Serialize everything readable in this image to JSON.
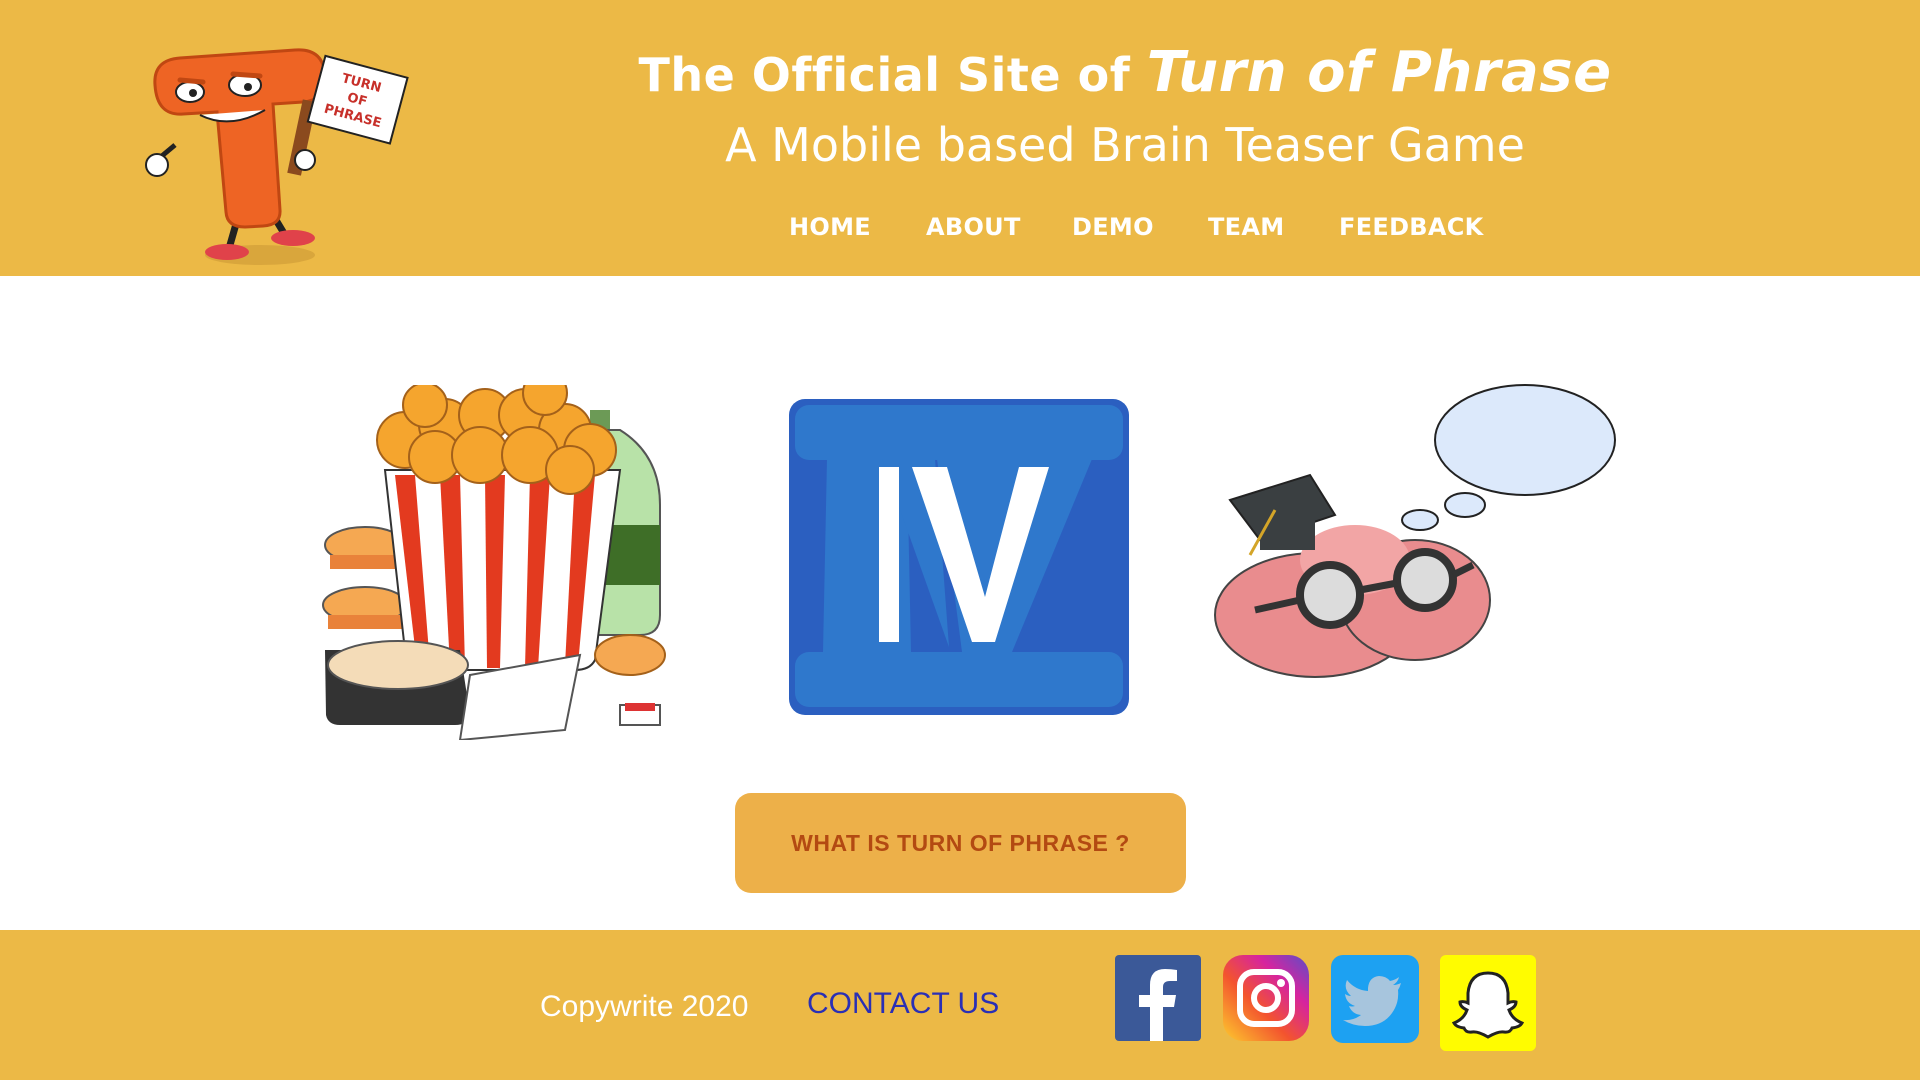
{
  "header": {
    "title_prefix": "The Official Site of ",
    "title_emphasis": "Turn of Phrase",
    "subtitle": "A Mobile based Brain Teaser Game",
    "mascot_sign": [
      "TURN",
      "OF",
      "PHRASE"
    ]
  },
  "nav": {
    "items": [
      {
        "label": "HOME"
      },
      {
        "label": "ABOUT"
      },
      {
        "label": "DEMO"
      },
      {
        "label": "TEAM"
      },
      {
        "label": "FEEDBACK"
      }
    ]
  },
  "main": {
    "puzzle_images": [
      "fried-chicken-bucket",
      "roman-numeral-four",
      "brain-with-glasses-thinking"
    ],
    "numeral_text": "IV",
    "cta_label": "WHAT IS TURN OF PHRASE ?"
  },
  "footer": {
    "copyright": "Copywrite 2020",
    "contact_label": "CONTACT US",
    "social": [
      {
        "name": "facebook-icon",
        "color": "#3b5998"
      },
      {
        "name": "instagram-icon",
        "color": "#d6249f"
      },
      {
        "name": "twitter-icon",
        "color": "#1da1f2"
      },
      {
        "name": "snapchat-icon",
        "color": "#fffc00"
      }
    ]
  },
  "colors": {
    "header_bg": "#ecb946",
    "cta_bg": "#edb049",
    "cta_text": "#b34a12",
    "contact_link": "#2a2fb5",
    "numeral_blue": "#2b6fc6"
  }
}
